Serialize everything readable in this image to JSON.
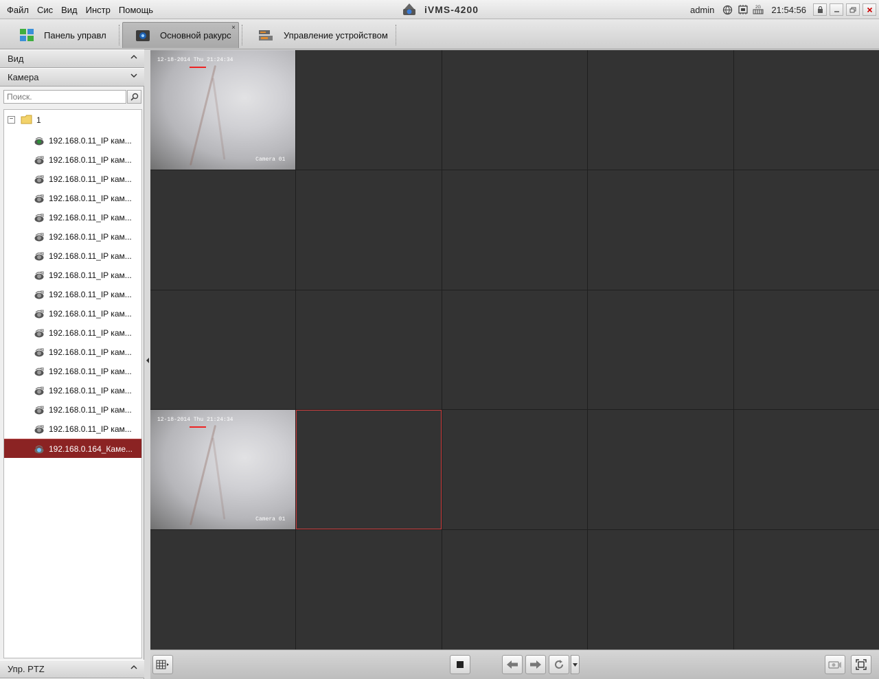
{
  "menu": [
    "Файл",
    "Сис",
    "Вид",
    "Инстр",
    "Помощь"
  ],
  "app": {
    "title": "iVMS-4200"
  },
  "header": {
    "user": "admin",
    "time": "21:54:56"
  },
  "tabs": [
    {
      "label": "Панель управл",
      "icon": "control-panel-icon"
    },
    {
      "label": "Основной ракурс",
      "icon": "main-view-icon",
      "active": true,
      "close": "×"
    },
    {
      "label": "Управление устройством",
      "icon": "device-management-icon"
    }
  ],
  "sidebar": {
    "view_header": "Вид",
    "camera_header": "Камера",
    "search_placeholder": "Поиск.",
    "root_label": "1",
    "root_expander": "−",
    "cameras": [
      "192.168.0.11_IP кам...",
      "192.168.0.11_IP кам...",
      "192.168.0.11_IP кам...",
      "192.168.0.11_IP кам...",
      "192.168.0.11_IP кам...",
      "192.168.0.11_IP кам...",
      "192.168.0.11_IP кам...",
      "192.168.0.11_IP кам...",
      "192.168.0.11_IP кам...",
      "192.168.0.11_IP кам...",
      "192.168.0.11_IP кам...",
      "192.168.0.11_IP кам...",
      "192.168.0.11_IP кам...",
      "192.168.0.11_IP кам...",
      "192.168.0.11_IP кам...",
      "192.168.0.11_IP кам...",
      "192.168.0.164_Каме..."
    ],
    "ptz_header": "Упр. PTZ"
  },
  "feeds": {
    "timestamp": "12-18-2014 Thu 21:24:34",
    "camera_name": "Camera 01"
  },
  "colors": {
    "selected_row": "#8b2323",
    "selected_cell_border": "#d04040",
    "grid_cell": "#333333"
  }
}
